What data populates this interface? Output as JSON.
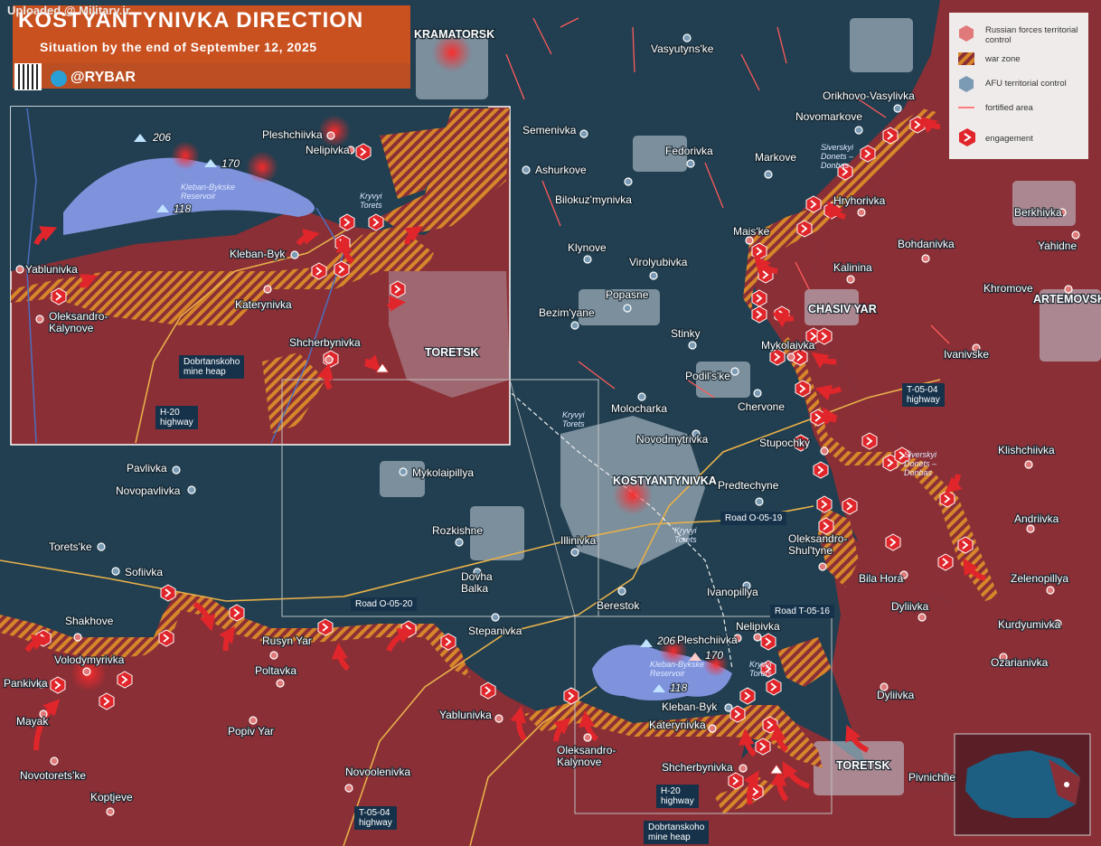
{
  "header": {
    "upload_note": "Uploaded @ Military.ir",
    "title": "KOSTYANTYNIVKA DIRECTION",
    "subtitle": "Situation by the end of September 12, 2025",
    "brand": "@RYBAR"
  },
  "legend": {
    "russian": "Russian forces territorial control",
    "war_zone": "war zone",
    "afu": "AFU territorial control",
    "fortified": "fortified area",
    "engagement": "engagement"
  },
  "colors": {
    "russian": "#8a2f36",
    "afu_bg": "#213f50",
    "town": "#c7d2dc",
    "war_zone": "#d7862a",
    "fortified": "#ff5a5a",
    "engagement": "#e0262b",
    "reservoir": "#7f93dd"
  },
  "cities": {
    "kramatorsk": "KRAMATORSK",
    "kostyantynivka": "KOSTYANTYNIVKA",
    "chasiv_yar": "CHASIV YAR",
    "artemovsk": "ARTEMOVSK",
    "toretsk": "TORETSK",
    "toretsk_inset": "TORETSK"
  },
  "places": {
    "vasyutynske": "Vasyutyns'ke",
    "orikhovo": "Orikhovo-Vasylivka",
    "novomarkove": "Novomarkove",
    "semenivka": "Semenivka",
    "fedorivka": "Fedorivka",
    "markove": "Markove",
    "ashurkove": "Ashurkove",
    "bilokuzmynivka": "Bilokuz'mynivka",
    "hryhorivka": "Hryhorivka",
    "berkhivka": "Berkhivka",
    "yahidne": "Yahidne",
    "bohdanivka": "Bohdanivka",
    "klynove": "Klynove",
    "virolyubivka": "Virolyubivka",
    "maiske": "Mais'ke",
    "kalinina": "Kalinina",
    "popasne": "Popasne",
    "khromove": "Khromove",
    "bezimyane": "Bezim'yane",
    "stinky": "Stinky",
    "mykolaivka": "Mykolaivka",
    "ivanivske": "Ivanivske",
    "podilske": "Podil's'ke",
    "chervone": "Chervone",
    "molocharka": "Molocharka",
    "novodmytrivka": "Novodmytrivka",
    "stupochky": "Stupochky",
    "klishchiivka": "Klishchiivka",
    "predtechyne": "Predtechyne",
    "pavlivka": "Pavlivka",
    "novopavlivka": "Novopavlivka",
    "mykolaipillya": "Mykolaipillya",
    "andriivka": "Andriivka",
    "oleksandro_shultyne": "Oleksandro-\nShul'tyne",
    "toretske": "Torets'ke",
    "rozkishne": "Rozkishne",
    "illinivka": "Illinivka",
    "sofiivka": "Sofiivka",
    "dovha_balka": "Dovha\nBalka",
    "bila_hora": "Bila Hora",
    "zelenopillya": "Zelenopillya",
    "ivanopillya": "Ivanopillya",
    "berestok": "Berestok",
    "dyliivka1": "Dyliivka",
    "kurdyumivka": "Kurdyumivka",
    "shakhove": "Shakhove",
    "volodymyrivka": "Volodymyrivka",
    "stepanivka": "Stepanivka",
    "rusyn_yar": "Rusyn Yar",
    "ozarianivka": "Ozarianivka",
    "pankivka": "Pankivka",
    "poltavka": "Poltavka",
    "mayak": "Mayak",
    "dyliivka2": "Dyliivka",
    "popiv_yar": "Popiv Yar",
    "yablunivka": "Yablunivka",
    "oleksandro_kalynove": "Oleksandro-\nKalynove",
    "katerynivka": "Katerynivka",
    "kleban_byk": "Kleban-Byk",
    "pleshchiivka": "Pleshchiivka",
    "nelipivka": "Nelipivka",
    "shcherbynivka": "Shcherbynivka",
    "pivnichne": "Pivnichne",
    "novotoretske": "Novotorets'ke",
    "novoolenivka": "Novoolenivka",
    "koptjeve": "Koptjeve"
  },
  "inset": {
    "pleshchiivka": "Pleshchiivka",
    "nelipivka": "Nelipivka",
    "yablunivka": "Yablunivka",
    "kleban_byk": "Kleban-Byk",
    "katerynivka": "Katerynivka",
    "oleksandro_kalynove": "Oleksandro-\nKalynove",
    "shcherbynivka": "Shcherbynivka",
    "reservoir": "Kleban-Bykske\nReservoir",
    "river": "Kryvyi\nTorets",
    "h20": "H-20\nhighway",
    "mine_heap": "Dobrtanskoho\nmine heap",
    "h206": "206",
    "h170": "170",
    "h118": "118"
  },
  "rivers": {
    "siverskyi1": "Siverskyi\nDonets –\nDonbas",
    "siverskyi2": "Siverskyi\nDonets –\nDonbas",
    "kryvyi1": "Kryvyi\nTorets",
    "kryvyi2": "Kryvyi\nTorets",
    "kryvyi3": "Kryvyi\nTorets",
    "reservoir": "Kleban-Bykske\nReservoir"
  },
  "heights": {
    "h206": "206",
    "h170": "170",
    "h118": "118"
  },
  "roads": {
    "t0504a": "T-05-04\nhighway",
    "t0504b": "T-05-04\nhighway",
    "o0519": "Road O-05-19",
    "o0520": "Road O-05-20",
    "t0516": "Road T-05-16",
    "h20": "H-20\nhighway",
    "mine_heap": "Dobrtanskoho\nmine heap"
  }
}
